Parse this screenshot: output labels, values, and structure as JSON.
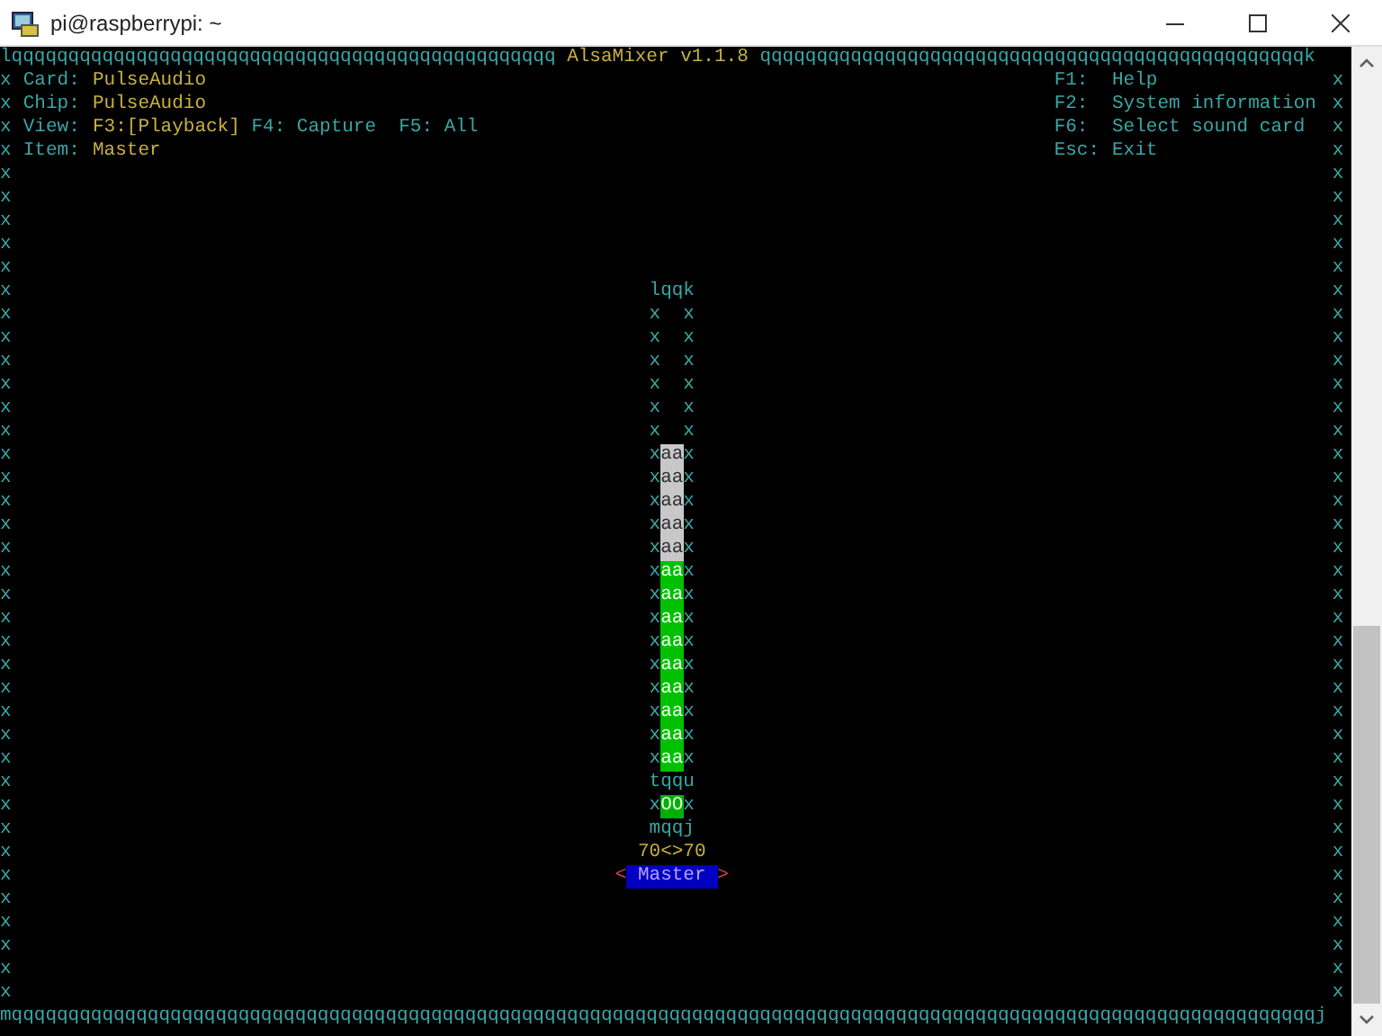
{
  "window": {
    "title": "pi@raspberrypi: ~"
  },
  "frame": {
    "top_left": "lqqqqqqqqqqqqqqqqqqqqqqqqqqqqqqqqqqqqqqqqqqqqqqqq",
    "title": "AlsaMixer v1.1.8",
    "top_right": "qqqqqqqqqqqqqqqqqqqqqqqqqqqqqqqqqqqqqqqqqqqqqqqqk",
    "side_left": "xxxxxxxxxxxxxxxxxxxxxxxxxxxxxxxxxxxxxxxx",
    "side_right": "xxxxxxxxxxxxxxxxxxxxxxxxxxxxxxxxxxxxxxxx",
    "bottom": "mqqqqqqqqqqqqqqqqqqqqqqqqqqqqqqqqqqqqqqqqqqqqqqqqqqqqqqqqqqqqqqqqqqqqqqqqqqqqqqqqqqqqqqqqqqqqqqqqqqqqqqqqqqqqqqqqqqqj"
  },
  "info": [
    {
      "label": "Card:",
      "value": "PulseAudio"
    },
    {
      "label": "Chip:",
      "value": "PulseAudio"
    }
  ],
  "view": {
    "label": "View:",
    "options": [
      {
        "text": "F3:[Playback]",
        "selected": true
      },
      {
        "text": "F4: Capture",
        "selected": false
      },
      {
        "text": "F5: All",
        "selected": false
      }
    ]
  },
  "item": {
    "label": "Item:",
    "value": "Master"
  },
  "help": [
    {
      "key": "F1:",
      "action": "Help"
    },
    {
      "key": "F2:",
      "action": "System information"
    },
    {
      "key": "F6:",
      "action": "Select sound card"
    },
    {
      "key": "Esc:",
      "action": "Exit"
    }
  ],
  "control": {
    "top": "lqqk",
    "side_left": "xxxxxxxxxxxxxxxxxxxx",
    "side_right": "xxxxxxxxxxxxxxxxxxxx",
    "fill": [
      "aa",
      "aa",
      "aa",
      "aa",
      "aa",
      "aa",
      "aa",
      "aa",
      "aa",
      "aa",
      "aa",
      "aa",
      "aa",
      "aa"
    ],
    "level": 0.7,
    "separator": "tqqu",
    "mute_left": "x",
    "mute": "OO",
    "muted": false,
    "mute_right": "x",
    "bottom": "mqqj",
    "volume": "70<>70",
    "arrow_left": "<",
    "name": "Master",
    "arrow_right": ">",
    "selected": true
  }
}
